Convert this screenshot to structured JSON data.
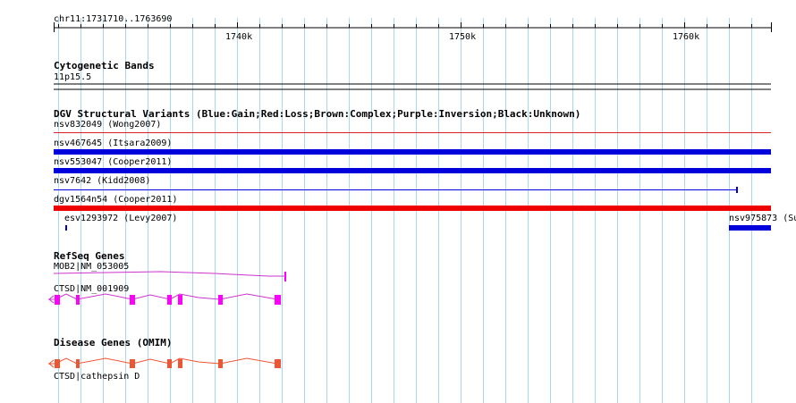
{
  "ruler": {
    "position": "chr11:1731710..1763690",
    "ticks": [
      "1740k",
      "1750k",
      "1760k"
    ]
  },
  "tracks": {
    "cytoband": {
      "title": "Cytogenetic Bands",
      "band": "11p15.5"
    },
    "dgv": {
      "title": "DGV Structural Variants (Blue:Gain;Red:Loss;Brown:Complex;Purple:Inversion;Black:Unknown)",
      "features": [
        {
          "label": "nsv832049 (Wong2007)",
          "color": "#dd2222"
        },
        {
          "label": "nsv467645 (Itsara2009)",
          "color": "#0000dd"
        },
        {
          "label": "nsv553047 (Cooper2011)",
          "color": "#0000dd"
        },
        {
          "label": "nsv7642 (Kidd2008)",
          "color": "#0000dd"
        },
        {
          "label": "dgv1564n54 (Cooper2011)",
          "color": "#ee0000"
        },
        {
          "label": "esv1293972 (Levy2007)",
          "color": "#0000dd"
        },
        {
          "label": "nsv975873 (Su",
          "color": "#0000dd"
        }
      ]
    },
    "refseq": {
      "title": "RefSeq Genes",
      "genes": [
        {
          "label": "MOB2|NM_053005",
          "color": "#cc33cc"
        },
        {
          "label": "CTSD|NM_001909",
          "color": "#cc33cc"
        }
      ],
      "exon_color": "#ff00ff"
    },
    "omim": {
      "title": "Disease Genes (OMIM)",
      "label": "CTSD|cathepsin D",
      "color": "#ee5533"
    }
  },
  "colors": {
    "grid": "#a8d8f0",
    "ruler": "#000000"
  }
}
